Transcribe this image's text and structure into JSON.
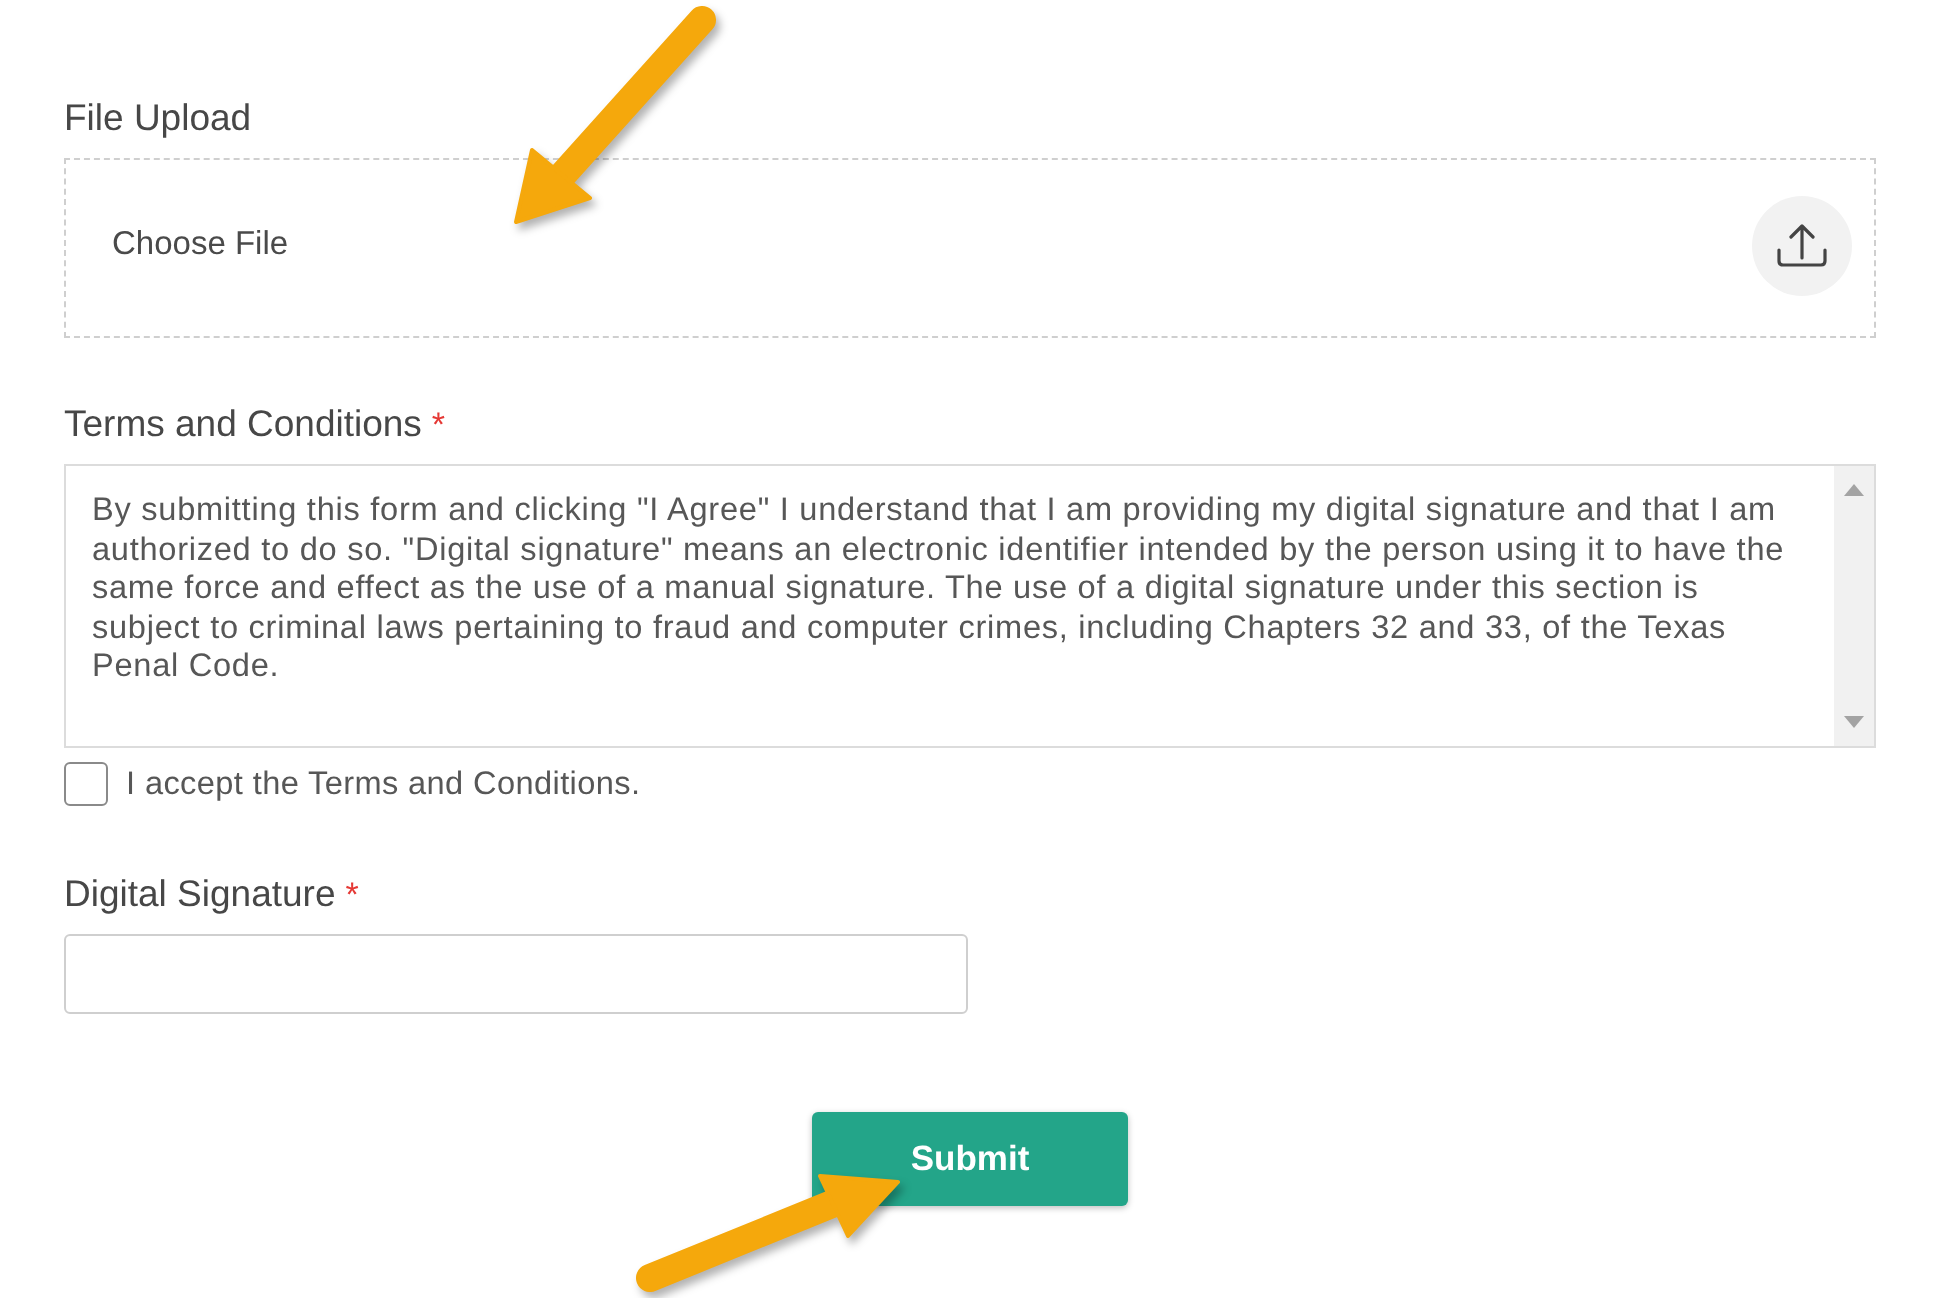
{
  "upload": {
    "label": "File Upload",
    "button": "Choose File"
  },
  "terms": {
    "label": "Terms and Conditions",
    "required_mark": "*",
    "text": "By submitting this form and clicking \"I Agree\" I understand that I am providing my digital signature and that I am authorized to do so. \"Digital signature\" means an electronic identifier intended by the person using it to have the same force and effect as the use of a manual signature. The use of a digital signature under this section is subject to criminal laws pertaining to fraud and computer crimes, including Chapters 32 and 33, of the Texas Penal Code.",
    "checkbox": {
      "label": "I accept the Terms and Conditions.",
      "checked": false
    }
  },
  "signature": {
    "label": "Digital Signature",
    "required_mark": "*"
  },
  "submit": {
    "label": "Submit"
  }
}
